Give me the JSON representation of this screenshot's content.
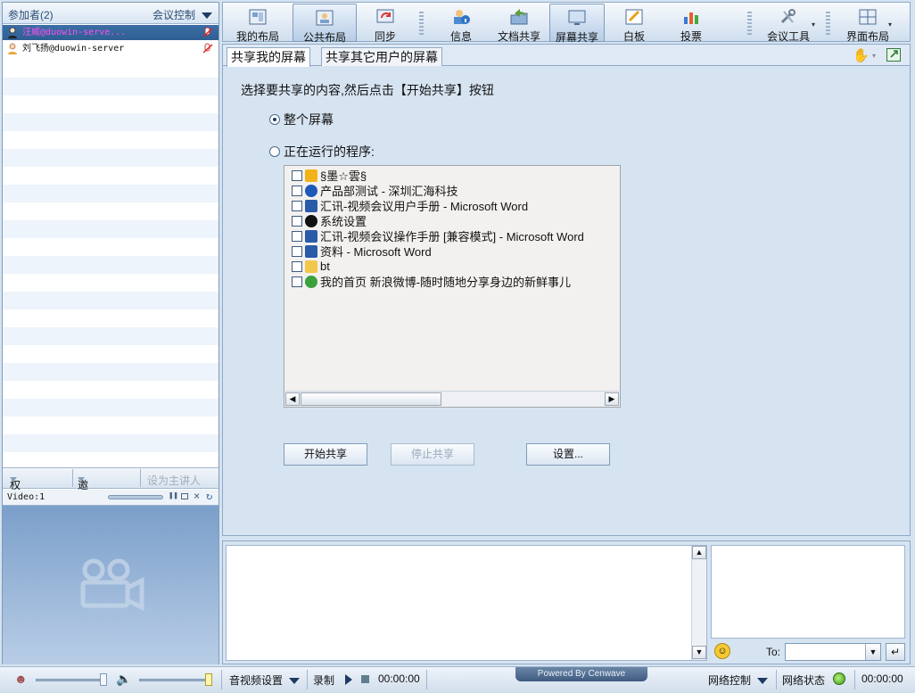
{
  "participants": {
    "title": "参加者",
    "count": "(2)",
    "control_label": "会议控制",
    "items": [
      {
        "name": "汪威@duowin-serve..."
      },
      {
        "name": "刘飞扬@duowin-server"
      }
    ],
    "permission_label": "权限设置",
    "invite_label": "邀请用户",
    "set_presenter_label": "设为主讲人",
    "video_label": "Video:1"
  },
  "toolbar": {
    "items": [
      {
        "label": "我的布局",
        "icon": "my-layout-icon"
      },
      {
        "label": "公共布局",
        "icon": "public-layout-icon",
        "active": true
      },
      {
        "label": "同步",
        "icon": "sync-icon"
      },
      {
        "label": "信息",
        "icon": "info-icon"
      },
      {
        "label": "文档共享",
        "icon": "doc-share-icon"
      },
      {
        "label": "屏幕共享",
        "icon": "screen-share-icon",
        "active": true
      },
      {
        "label": "白板",
        "icon": "whiteboard-icon"
      },
      {
        "label": "投票",
        "icon": "vote-icon"
      },
      {
        "label": "会议工具",
        "icon": "tools-icon"
      },
      {
        "label": "界面布局",
        "icon": "ui-layout-icon"
      }
    ]
  },
  "share": {
    "tab_mine": "共享我的屏幕",
    "tab_others": "共享其它用户的屏幕",
    "instruction": "选择要共享的内容,然后点击【开始共享】按钮",
    "option_fullscreen": "整个屏幕",
    "option_programs": "正在运行的程序:",
    "programs": [
      {
        "title": "§墨☆雲§",
        "icon": "folder-icon"
      },
      {
        "title": "产品部测试 - 深圳汇海科技",
        "icon": "app-icon"
      },
      {
        "title": "汇讯-视频会议用户手册 - Microsoft Word",
        "icon": "word-icon"
      },
      {
        "title": "系统设置",
        "icon": "qq-icon"
      },
      {
        "title": "汇讯-视频会议操作手册 [兼容模式] - Microsoft Word",
        "icon": "word-icon"
      },
      {
        "title": "资料 - Microsoft Word",
        "icon": "word-icon"
      },
      {
        "title": "bt",
        "icon": "folder-icon"
      },
      {
        "title": "我的首页 新浪微博-随时随地分享身边的新鲜事儿",
        "icon": "ie-icon"
      }
    ],
    "start_label": "开始共享",
    "stop_label": "停止共享",
    "settings_label": "设置..."
  },
  "chat": {
    "to_label": "To:"
  },
  "status": {
    "av_settings": "音视频设置",
    "record": "录制",
    "time1": "00:00:00",
    "powered": "Powered By Cenwave",
    "network_control": "网络控制",
    "network_status": "网络状态",
    "time2": "00:00:00"
  }
}
